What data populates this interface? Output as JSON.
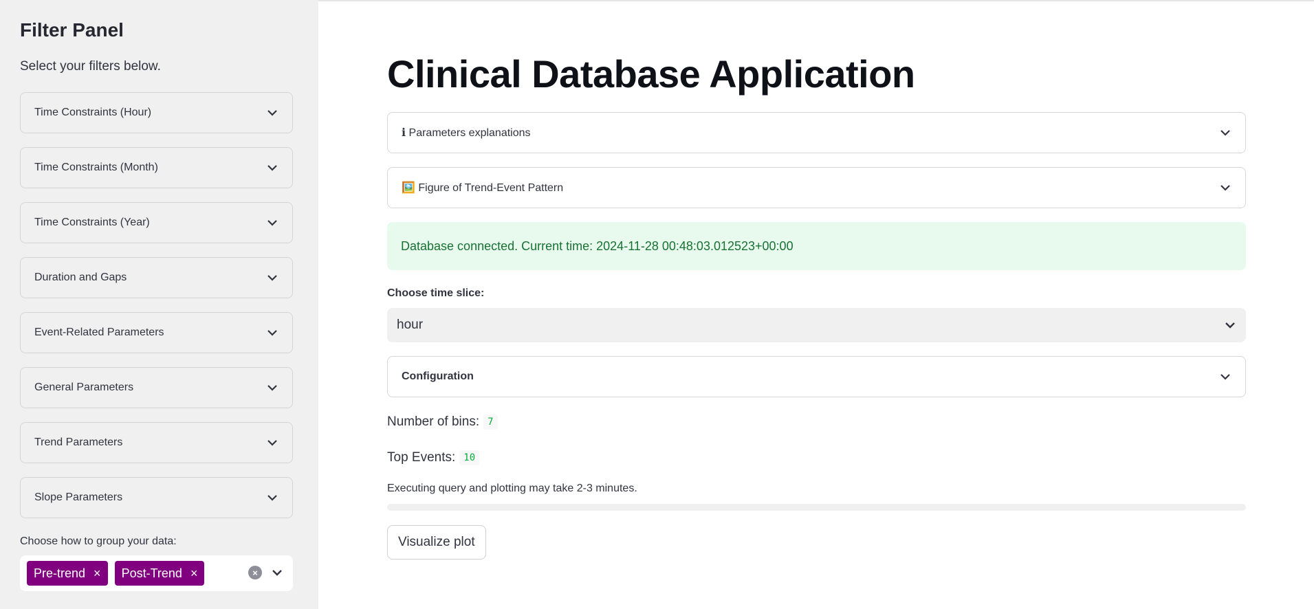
{
  "sidebar": {
    "title": "Filter Panel",
    "subtitle": "Select your filters below.",
    "expanders": [
      {
        "label": "Time Constraints (Hour)"
      },
      {
        "label": "Time Constraints (Month)"
      },
      {
        "label": "Time Constraints (Year)"
      },
      {
        "label": "Duration and Gaps"
      },
      {
        "label": "Event-Related Parameters"
      },
      {
        "label": "General Parameters"
      },
      {
        "label": "Trend Parameters"
      },
      {
        "label": "Slope Parameters"
      }
    ],
    "group_label": "Choose how to group your data:",
    "group_tags": [
      {
        "label": "Pre-trend",
        "remove": "×"
      },
      {
        "label": "Post-Trend",
        "remove": "×"
      }
    ],
    "clear_glyph": "×",
    "accent_color": "#800080"
  },
  "main": {
    "title": "Clinical Database Application",
    "expander_params": {
      "icon": "info-icon",
      "glyph": "ℹ",
      "label": "Parameters explanations"
    },
    "expander_figure": {
      "icon": "framed-picture-icon",
      "glyph": "🖼️",
      "label": "Figure of Trend-Event Pattern"
    },
    "status": "Database connected. Current time: 2024-11-28 00:48:03.012523+00:00",
    "time_slice_label": "Choose time slice:",
    "time_slice_value": "hour",
    "configuration_label": "Configuration",
    "bins_label": "Number of bins:",
    "bins_value": "7",
    "top_events_label": "Top Events:",
    "top_events_value": "10",
    "exec_note": "Executing query and plotting may take 2-3 minutes.",
    "progress": 0,
    "visualize_button": "Visualize plot"
  }
}
